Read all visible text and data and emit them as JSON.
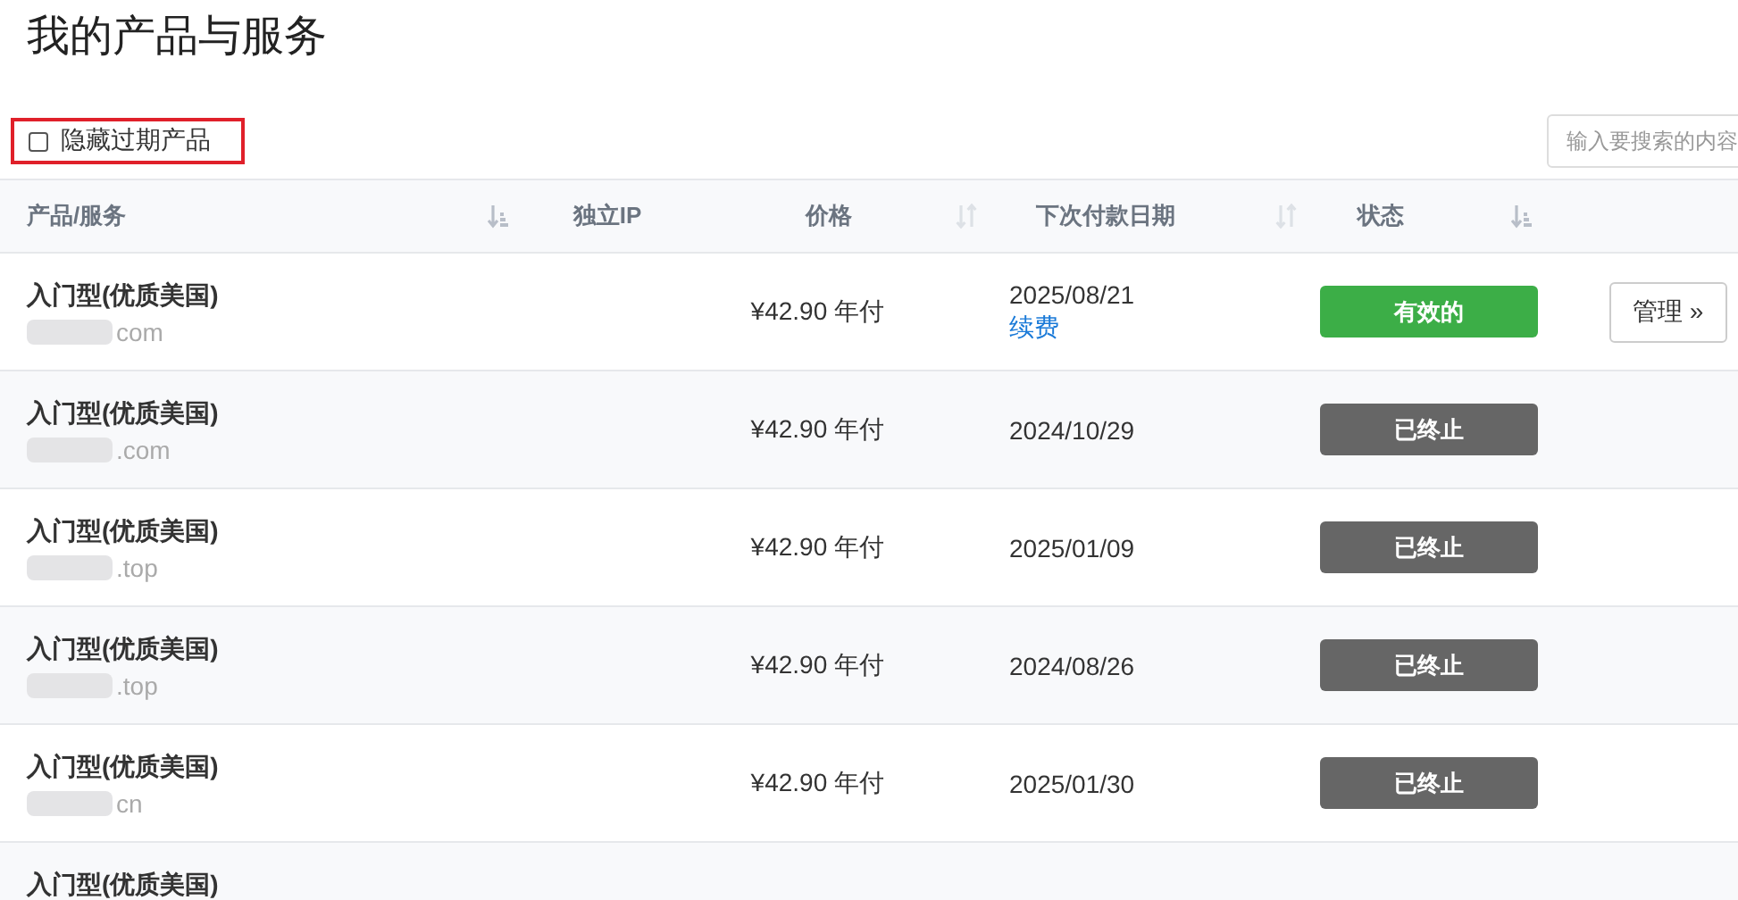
{
  "title": "我的产品与服务",
  "filter": {
    "label": "隐藏过期产品",
    "checked": false
  },
  "search": {
    "placeholder": "输入要搜索的内容"
  },
  "table": {
    "columns": [
      {
        "label": "产品/服务",
        "kind": "ranked"
      },
      {
        "label": "独立IP",
        "kind": "plain"
      },
      {
        "label": "价格",
        "kind": "sortable"
      },
      {
        "label": "下次付款日期",
        "kind": "sortable"
      },
      {
        "label": "状态",
        "kind": "ranked"
      }
    ],
    "rows": [
      {
        "name": "入门型(优质美国)",
        "domain": "com",
        "price": "¥42.90 年付",
        "date": "2025/08/21",
        "renew": "续费",
        "status": {
          "label": "有效的",
          "kind": "active"
        },
        "manage": "管理 »"
      },
      {
        "name": "入门型(优质美国)",
        "domain": ".com",
        "price": "¥42.90 年付",
        "date": "2024/10/29",
        "status": {
          "label": "已终止",
          "kind": "terminated"
        }
      },
      {
        "name": "入门型(优质美国)",
        "domain": ".top",
        "price": "¥42.90 年付",
        "date": "2025/01/09",
        "status": {
          "label": "已终止",
          "kind": "terminated"
        }
      },
      {
        "name": "入门型(优质美国)",
        "domain": ".top",
        "price": "¥42.90 年付",
        "date": "2024/08/26",
        "status": {
          "label": "已终止",
          "kind": "terminated"
        }
      },
      {
        "name": "入门型(优质美国)",
        "domain": "cn",
        "price": "¥42.90 年付",
        "date": "2025/01/30",
        "status": {
          "label": "已终止",
          "kind": "terminated"
        }
      },
      {
        "name": "入门型(优质美国)"
      }
    ]
  }
}
